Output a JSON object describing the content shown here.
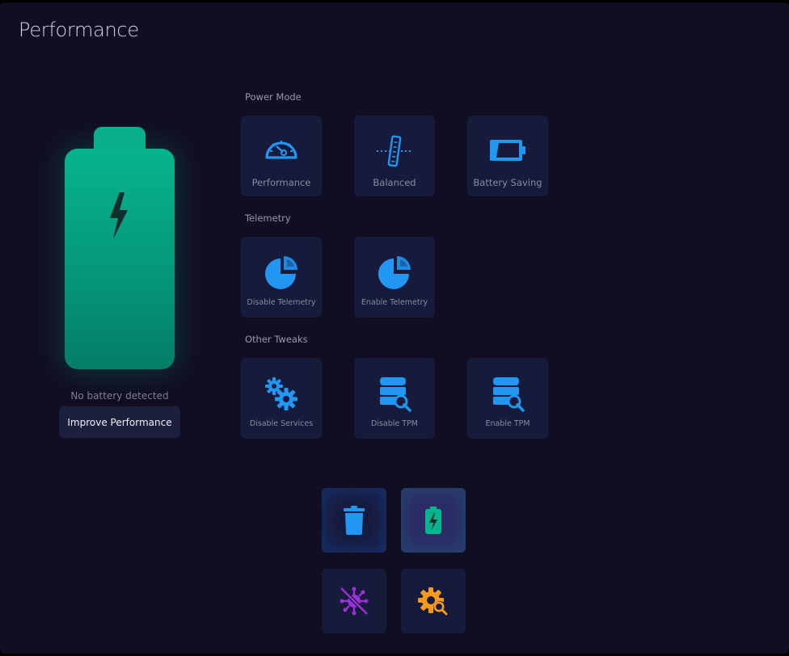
{
  "window": {
    "title": "Performance"
  },
  "battery": {
    "status_text": "No battery detected",
    "improve_button": "Improve Performance",
    "color": "#06b48d"
  },
  "sections": {
    "power_mode": {
      "label": "Power Mode",
      "items": [
        {
          "label": "Performance",
          "icon": "speedometer-icon"
        },
        {
          "label": "Balanced",
          "icon": "balance-icon"
        },
        {
          "label": "Battery Saving",
          "icon": "battery-saving-icon"
        }
      ]
    },
    "telemetry": {
      "label": "Telemetry",
      "items": [
        {
          "label": "Disable Telemetry",
          "icon": "pie-chart-icon"
        },
        {
          "label": "Enable Telemetry",
          "icon": "pie-chart-icon"
        }
      ]
    },
    "other_tweaks": {
      "label": "Other Tweaks",
      "items": [
        {
          "label": "Disable Services",
          "icon": "gears-icon"
        },
        {
          "label": "Disable TPM",
          "icon": "database-key-icon"
        },
        {
          "label": "Enable TPM",
          "icon": "database-key-icon"
        }
      ]
    }
  },
  "dock": {
    "items": [
      {
        "icon": "trash-icon",
        "active": false
      },
      {
        "icon": "battery-charging-icon",
        "active": true
      },
      {
        "icon": "virus-blocked-icon",
        "active": false
      },
      {
        "icon": "gear-search-icon",
        "active": false
      }
    ]
  },
  "colors": {
    "background": "#110d22",
    "tile": "#161a3b",
    "accent_blue": "#2196f3",
    "accent_green": "#06b48d",
    "accent_purple": "#9b30d9",
    "accent_orange": "#f59a1b"
  }
}
